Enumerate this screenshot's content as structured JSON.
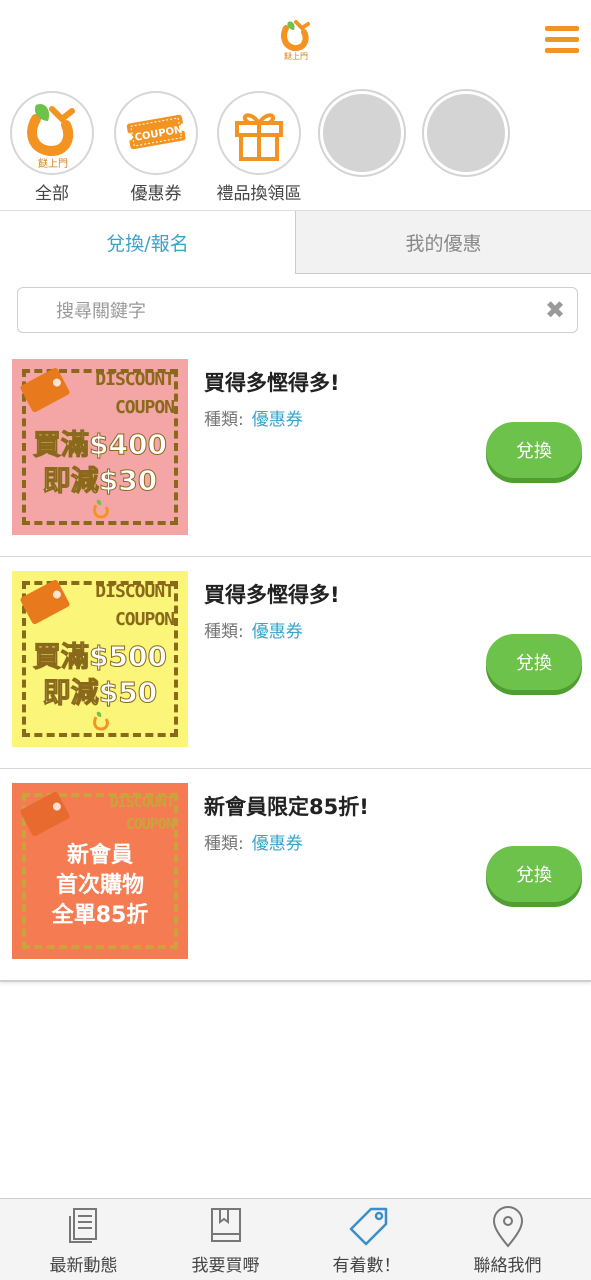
{
  "header": {
    "menu_icon": "hamburger-menu-icon",
    "logo_icon": "brand-logo-icon",
    "logo_text": "餸上門"
  },
  "categories": [
    {
      "label": "全部",
      "icon": "brand-logo-icon"
    },
    {
      "label": "優惠券",
      "icon": "coupon-icon",
      "icon_text": "COUPON"
    },
    {
      "label": "禮品換領區",
      "icon": "gift-icon"
    },
    {
      "label": "",
      "icon": "empty-circle"
    },
    {
      "label": "",
      "icon": "empty-circle"
    }
  ],
  "tabs": [
    {
      "label": "兌換/報名",
      "active": true
    },
    {
      "label": "我的優惠",
      "active": false
    }
  ],
  "search": {
    "placeholder": "搜尋關鍵字",
    "value": "",
    "clear_icon": "close-icon"
  },
  "type_label": "種類:",
  "coupons": [
    {
      "title": "買得多慳得多!",
      "type": "優惠券",
      "button": "兌換",
      "image": {
        "bg": "#f4a6a6",
        "line1": "DISCOUNT",
        "line2": "COUPON",
        "big1": "買滿$400",
        "big2": "即減$30"
      }
    },
    {
      "title": "買得多慳得多!",
      "type": "優惠券",
      "button": "兌換",
      "image": {
        "bg": "#fbf57a",
        "line1": "DISCOUNT",
        "line2": "COUPON",
        "big1": "買滿$500",
        "big2": "即減$50"
      }
    },
    {
      "title": "新會員限定85折!",
      "type": "優惠券",
      "button": "兌換",
      "image": {
        "bg": "#f47b52",
        "line1": "DISCOUNT",
        "line2": "COUPON",
        "big1": "新會員",
        "big2": "首次購物",
        "big3": "全單85折"
      }
    }
  ],
  "bottom_nav": [
    {
      "label": "最新動態",
      "icon": "news-icon"
    },
    {
      "label": "我要買嘢",
      "icon": "book-icon"
    },
    {
      "label": "有着數！",
      "icon": "price-tag-icon",
      "active": true
    },
    {
      "label": "聯絡我們",
      "icon": "location-pin-icon"
    }
  ],
  "colors": {
    "accent": "#f39422",
    "link": "#3aa3c9",
    "button": "#6cc24a",
    "active_nav": "#3a8fc9"
  }
}
